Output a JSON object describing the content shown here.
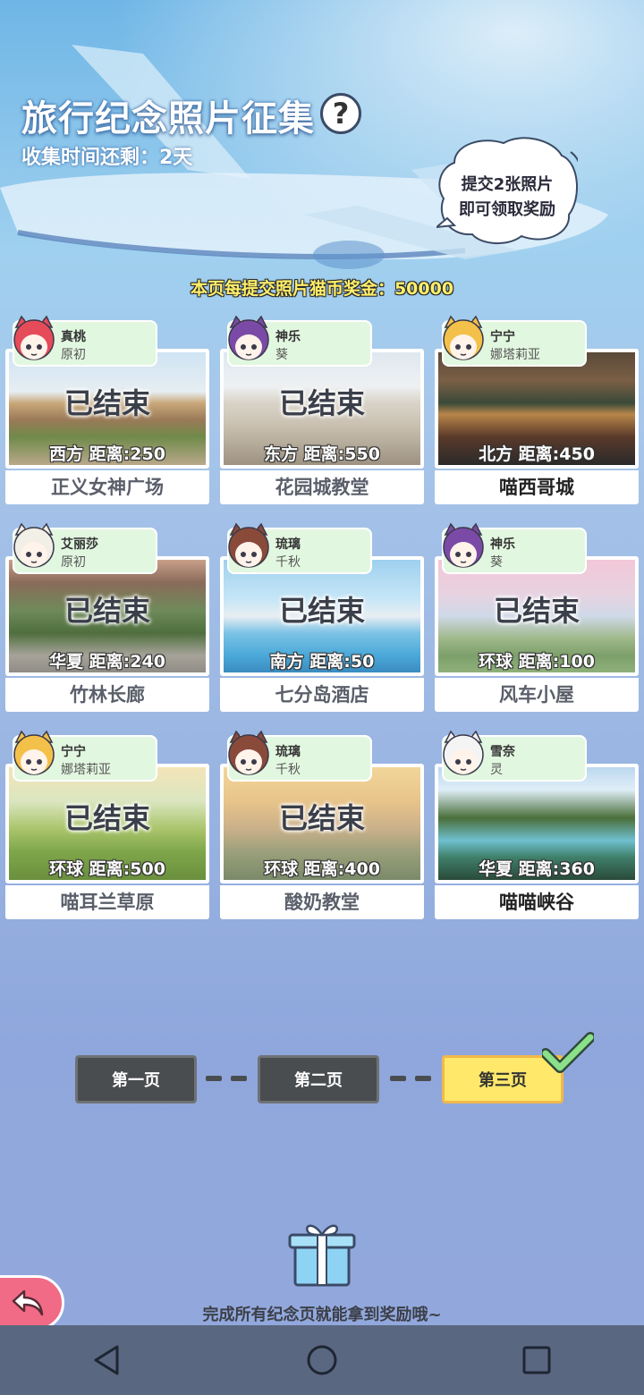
{
  "header": {
    "title": "旅行纪念照片征集",
    "help_symbol": "?",
    "time_left": "收集时间还剩：2天",
    "bubble_line1": "提交2张照片",
    "bubble_line2": "即可领取奖励",
    "bonus_text": "本页每提交照片猫币奖金：50000"
  },
  "cards": [
    {
      "char_name": "真桃",
      "char_sub": "原初",
      "status": "已结束",
      "distance": "西方  距离:250",
      "place": "正义女神广场",
      "caption_active": false,
      "photo_theme": "plaza"
    },
    {
      "char_name": "神乐",
      "char_sub": "葵",
      "status": "已结束",
      "distance": "东方  距离:550",
      "place": "花园城教堂",
      "caption_active": false,
      "photo_theme": "church"
    },
    {
      "char_name": "宁宁",
      "char_sub": "娜塔莉亚",
      "status": "",
      "distance": "北方  距离:450",
      "place": "喵西哥城",
      "caption_active": true,
      "photo_theme": "mexico"
    },
    {
      "char_name": "艾丽莎",
      "char_sub": "原初",
      "status": "已结束",
      "distance": "华夏  距离:240",
      "place": "竹林长廊",
      "caption_active": false,
      "photo_theme": "corridor"
    },
    {
      "char_name": "琉璃",
      "char_sub": "千秋",
      "status": "已结束",
      "distance": "南方  距离:50",
      "place": "七分岛酒店",
      "caption_active": false,
      "photo_theme": "hotel"
    },
    {
      "char_name": "神乐",
      "char_sub": "葵",
      "status": "已结束",
      "distance": "环球  距离:100",
      "place": "风车小屋",
      "caption_active": false,
      "photo_theme": "windmill"
    },
    {
      "char_name": "宁宁",
      "char_sub": "娜塔莉亚",
      "status": "已结束",
      "distance": "环球  距离:500",
      "place": "喵耳兰草原",
      "caption_active": false,
      "photo_theme": "meadow"
    },
    {
      "char_name": "琉璃",
      "char_sub": "千秋",
      "status": "已结束",
      "distance": "环球  距离:400",
      "place": "酸奶教堂",
      "caption_active": false,
      "photo_theme": "cathedral"
    },
    {
      "char_name": "雪奈",
      "char_sub": "灵",
      "status": "",
      "distance": "华夏  距离:360",
      "place": "喵喵峡谷",
      "caption_active": true,
      "photo_theme": "canyon"
    }
  ],
  "pagination": {
    "page1": "第一页",
    "page2": "第二页",
    "page3": "第三页",
    "current": 3
  },
  "footer": {
    "finish_message": "完成所有纪念页就能拿到奖励哦~"
  },
  "icons": {
    "help": "question-mark-icon",
    "gift": "gift-box-icon",
    "back": "back-arrow-icon",
    "check": "checkmark-icon",
    "nav_back": "triangle-back-icon",
    "nav_home": "circle-home-icon",
    "nav_recent": "square-recent-icon"
  },
  "colors": {
    "tag_bg": "#e2f7e0",
    "pager_active": "#ffe86a",
    "pager_inactive": "#4a4d50",
    "back_button": "#f16b86",
    "check": "#8be08a",
    "bonus_text": "#ffef6a"
  }
}
